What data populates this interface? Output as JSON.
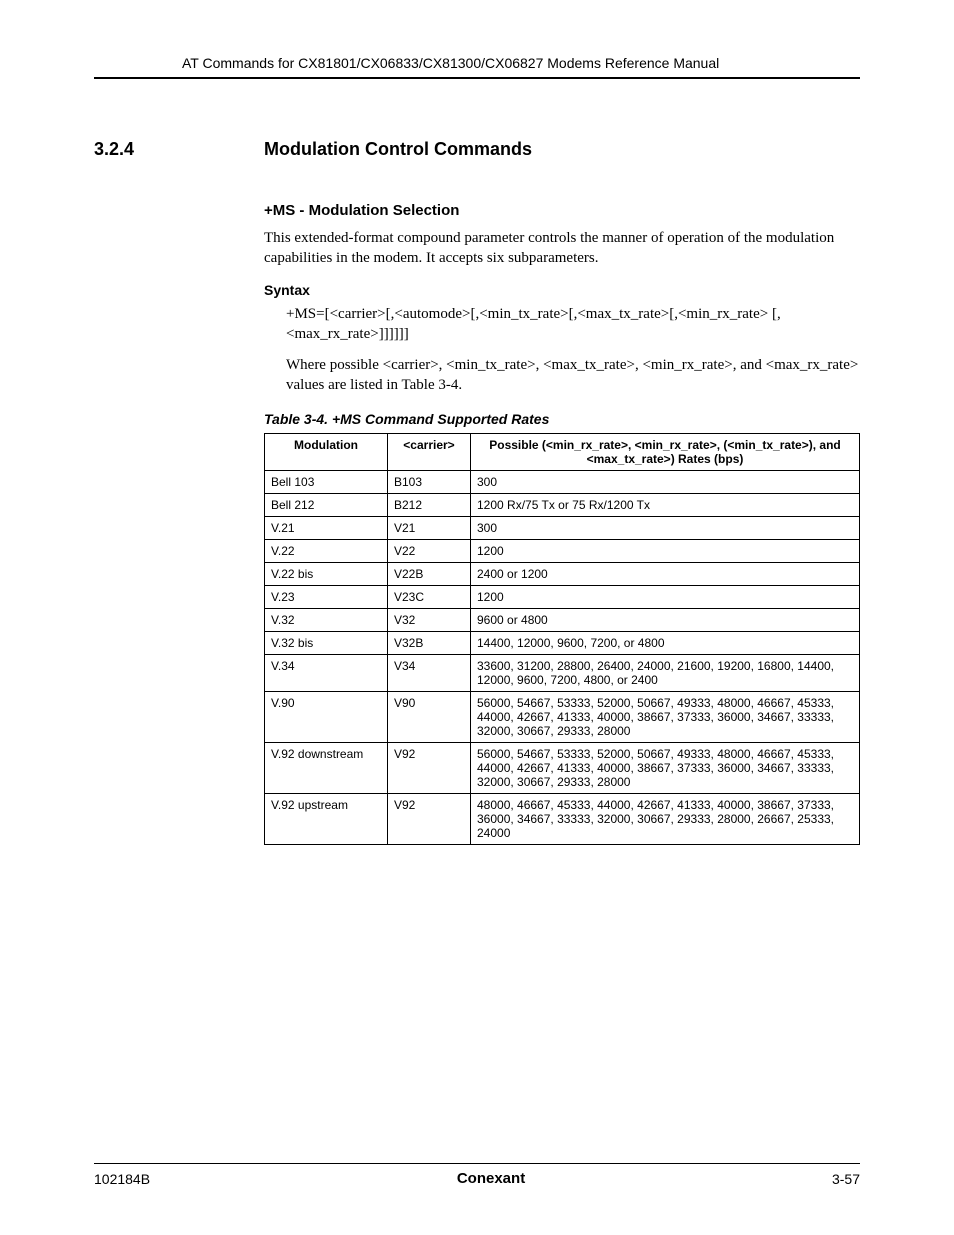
{
  "header": {
    "running_title": "AT Commands for CX81801/CX06833/CX81300/CX06827 Modems Reference Manual"
  },
  "section": {
    "number": "3.2.4",
    "title": "Modulation Control Commands"
  },
  "subsection": {
    "title": "+MS - Modulation Selection",
    "intro": "This extended-format compound parameter controls the manner of operation of the modulation capabilities in the modem. It accepts six subparameters."
  },
  "syntax": {
    "heading": "Syntax",
    "line1": "+MS=[<carrier>[,<automode>[,<min_tx_rate>[,<max_tx_rate>[,<min_rx_rate> [,<max_rx_rate>]]]]]]",
    "line2": "Where possible <carrier>, <min_tx_rate>, <max_tx_rate>, <min_rx_rate>, and <max_rx_rate> values are listed in Table 3-4."
  },
  "table": {
    "caption": "Table 3-4. +MS Command Supported Rates",
    "headers": {
      "col1": "Modulation",
      "col2": "<carrier>",
      "col3": "Possible (<min_rx_rate>, <min_rx_rate>, (<min_tx_rate>), and <max_tx_rate>) Rates (bps)"
    },
    "rows": [
      {
        "mod": "Bell 103",
        "carrier": "B103",
        "rates": "300"
      },
      {
        "mod": "Bell 212",
        "carrier": "B212",
        "rates": "1200 Rx/75 Tx or 75 Rx/1200 Tx"
      },
      {
        "mod": "V.21",
        "carrier": "V21",
        "rates": "300"
      },
      {
        "mod": "V.22",
        "carrier": "V22",
        "rates": "1200"
      },
      {
        "mod": "V.22 bis",
        "carrier": "V22B",
        "rates": "2400 or 1200"
      },
      {
        "mod": "V.23",
        "carrier": "V23C",
        "rates": "1200"
      },
      {
        "mod": "V.32",
        "carrier": "V32",
        "rates": "9600 or 4800"
      },
      {
        "mod": "V.32 bis",
        "carrier": "V32B",
        "rates": "14400, 12000, 9600, 7200, or 4800"
      },
      {
        "mod": "V.34",
        "carrier": "V34",
        "rates": "33600, 31200, 28800, 26400, 24000, 21600, 19200, 16800, 14400, 12000, 9600, 7200, 4800, or 2400"
      },
      {
        "mod": "V.90",
        "carrier": "V90",
        "rates": "56000, 54667, 53333, 52000, 50667, 49333, 48000, 46667, 45333, 44000, 42667, 41333, 40000, 38667, 37333, 36000, 34667, 33333, 32000, 30667, 29333, 28000"
      },
      {
        "mod": "V.92 downstream",
        "carrier": "V92",
        "rates": "56000, 54667, 53333, 52000, 50667, 49333, 48000, 46667, 45333, 44000, 42667, 41333, 40000, 38667, 37333, 36000, 34667, 33333, 32000, 30667, 29333, 28000"
      },
      {
        "mod": "V.92 upstream",
        "carrier": "V92",
        "rates": "48000, 46667, 45333, 44000, 42667, 41333, 40000, 38667, 37333, 36000, 34667, 33333, 32000, 30667, 29333, 28000, 26667, 25333, 24000"
      }
    ]
  },
  "footer": {
    "doc_number": "102184B",
    "brand": "Conexant",
    "page": "3-57"
  }
}
